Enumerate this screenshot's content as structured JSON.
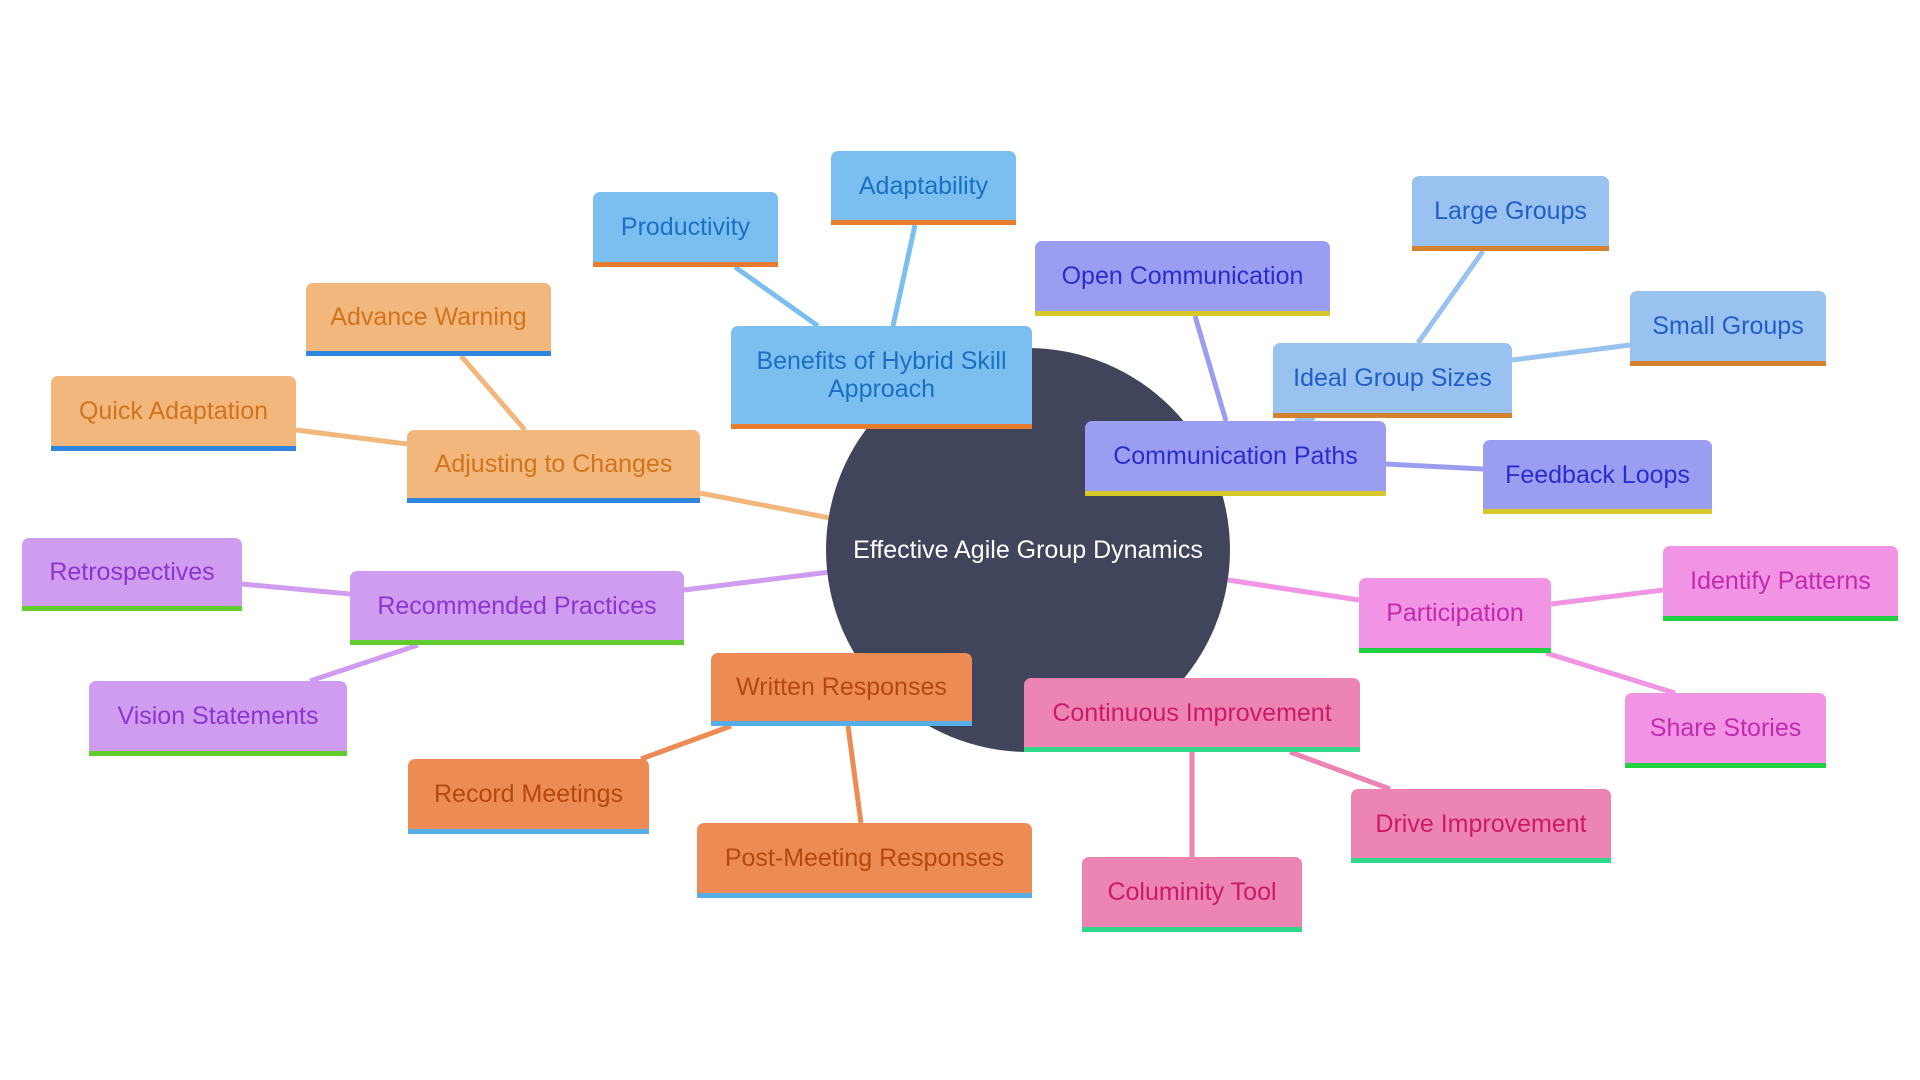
{
  "diagram": {
    "type": "mindmap",
    "root": {
      "id": "root",
      "label": "Effective Agile Group Dynamics",
      "fill": "#41455c",
      "text_color": "#ffffff"
    },
    "nodes": [
      {
        "id": "benefits",
        "parent": "root",
        "label": "Benefits of Hybrid Skill Approach",
        "fill": "#7bbff0",
        "text": "#1d6fc2",
        "underline": "#e87c2e",
        "edge": "#7bbff0"
      },
      {
        "id": "productivity",
        "parent": "benefits",
        "label": "Productivity",
        "fill": "#7bbff0",
        "text": "#1d6fc2",
        "underline": "#e87c2e",
        "edge": "#7bbff0"
      },
      {
        "id": "adaptability",
        "parent": "benefits",
        "label": "Adaptability",
        "fill": "#7bbff0",
        "text": "#1d6fc2",
        "underline": "#e87c2e",
        "edge": "#7bbff0"
      },
      {
        "id": "adjusting",
        "parent": "root",
        "label": "Adjusting to Changes",
        "fill": "#f2b77c",
        "text": "#d1741c",
        "underline": "#2e86de",
        "edge": "#f2b77c"
      },
      {
        "id": "advance",
        "parent": "adjusting",
        "label": "Advance Warning",
        "fill": "#f2b77c",
        "text": "#d1741c",
        "underline": "#2e86de",
        "edge": "#f2b77c"
      },
      {
        "id": "quick",
        "parent": "adjusting",
        "label": "Quick Adaptation",
        "fill": "#f2b77c",
        "text": "#d1741c",
        "underline": "#2e86de",
        "edge": "#f2b77c"
      },
      {
        "id": "recommended",
        "parent": "root",
        "label": "Recommended Practices",
        "fill": "#cf9cf0",
        "text": "#8e34cf",
        "underline": "#62cc2e",
        "edge": "#cf9cf0"
      },
      {
        "id": "retro",
        "parent": "recommended",
        "label": "Retrospectives",
        "fill": "#cf9cf0",
        "text": "#8e34cf",
        "underline": "#62cc2e",
        "edge": "#cf9cf0"
      },
      {
        "id": "vision",
        "parent": "recommended",
        "label": "Vision Statements",
        "fill": "#cf9cf0",
        "text": "#8e34cf",
        "underline": "#62cc2e",
        "edge": "#cf9cf0"
      },
      {
        "id": "written",
        "parent": "root",
        "label": "Written Responses",
        "fill": "#ec8c54",
        "text": "#b5480f",
        "underline": "#56aee6",
        "edge": "#ec8c54"
      },
      {
        "id": "record",
        "parent": "written",
        "label": "Record Meetings",
        "fill": "#ec8c54",
        "text": "#b5480f",
        "underline": "#56aee6",
        "edge": "#ec8c54"
      },
      {
        "id": "postmeeting",
        "parent": "written",
        "label": "Post-Meeting Responses",
        "fill": "#ec8c54",
        "text": "#b5480f",
        "underline": "#56aee6",
        "edge": "#ec8c54"
      },
      {
        "id": "continuous",
        "parent": "root",
        "label": "Continuous Improvement",
        "fill": "#ec84b4",
        "text": "#cc1a68",
        "underline": "#30d68a",
        "edge": "#ec84b4"
      },
      {
        "id": "drive",
        "parent": "continuous",
        "label": "Drive Improvement",
        "fill": "#ec84b4",
        "text": "#cc1a68",
        "underline": "#30d68a",
        "edge": "#ec84b4"
      },
      {
        "id": "columinity",
        "parent": "continuous",
        "label": "Columinity Tool",
        "fill": "#ec84b4",
        "text": "#cc1a68",
        "underline": "#30d68a",
        "edge": "#ec84b4"
      },
      {
        "id": "participation",
        "parent": "root",
        "label": "Participation",
        "fill": "#f294e4",
        "text": "#c22ab0",
        "underline": "#22d042",
        "edge": "#f294e4"
      },
      {
        "id": "identify",
        "parent": "participation",
        "label": "Identify Patterns",
        "fill": "#f294e4",
        "text": "#c22ab0",
        "underline": "#22d042",
        "edge": "#f294e4"
      },
      {
        "id": "share",
        "parent": "participation",
        "label": "Share Stories",
        "fill": "#f294e4",
        "text": "#c22ab0",
        "underline": "#22d042",
        "edge": "#f294e4"
      },
      {
        "id": "commpaths",
        "parent": "root",
        "label": "Communication Paths",
        "fill": "#9b9ef0",
        "text": "#2c2ccc",
        "underline": "#d6c82a",
        "edge": "#9b9ef0"
      },
      {
        "id": "opencomm",
        "parent": "commpaths",
        "label": "Open Communication",
        "fill": "#9b9ef0",
        "text": "#2c2ccc",
        "underline": "#d6c82a",
        "edge": "#9b9ef0"
      },
      {
        "id": "feedback",
        "parent": "commpaths",
        "label": "Feedback Loops",
        "fill": "#9b9ef0",
        "text": "#2c2ccc",
        "underline": "#d6c82a",
        "edge": "#9b9ef0"
      },
      {
        "id": "ideal",
        "parent": "commpaths",
        "label": "Ideal Group Sizes",
        "fill": "#9ac2f0",
        "text": "#1f5fc6",
        "underline": "#d4822e",
        "edge": "#9ac2f0"
      },
      {
        "id": "large",
        "parent": "ideal",
        "label": "Large Groups",
        "fill": "#9ac2f0",
        "text": "#1f5fc6",
        "underline": "#d4822e",
        "edge": "#9ac2f0"
      },
      {
        "id": "small",
        "parent": "ideal",
        "label": "Small Groups",
        "fill": "#9ac2f0",
        "text": "#1f5fc6",
        "underline": "#d4822e",
        "edge": "#9ac2f0"
      }
    ]
  }
}
